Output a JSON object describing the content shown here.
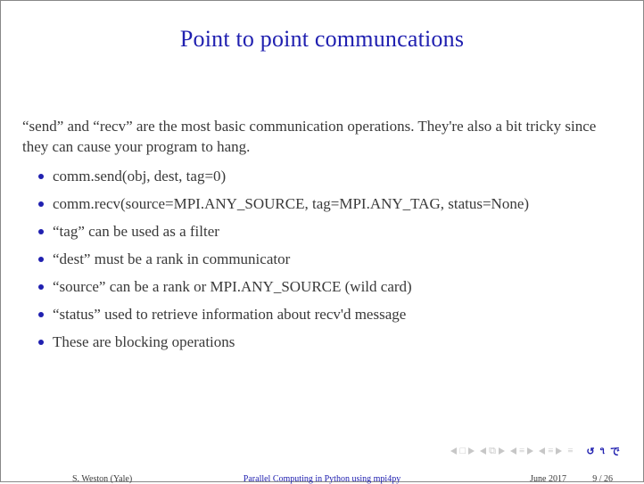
{
  "title": "Point to point communcations",
  "intro": "“send” and “recv” are the most basic communication operations. They're also a bit tricky since they can cause your program to hang.",
  "bullets": [
    "comm.send(obj, dest, tag=0)",
    "comm.recv(source=MPI.ANY_SOURCE, tag=MPI.ANY_TAG, status=None)",
    "“tag” can be used as a filter",
    "“dest” must be a rank in communicator",
    "“source” can be a rank or MPI.ANY_SOURCE (wild card)",
    "“status” used to retrieve information about recv'd message",
    "These are blocking operations"
  ],
  "footer": {
    "author": "S. Weston (Yale)",
    "center": "Parallel Computing in Python using mpi4py",
    "date": "June 2017",
    "page": "9 / 26"
  },
  "nav": {
    "square": "□",
    "page_icon": "⧉",
    "eq": "≡",
    "undo": "↺",
    "q": "▹",
    "c": "◃"
  }
}
